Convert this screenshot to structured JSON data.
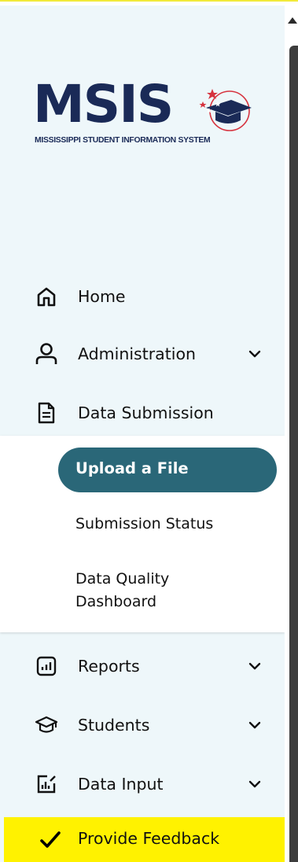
{
  "logo": {
    "wordmark": "MSIS",
    "tagline": "MISSISSIPPI STUDENT INFORMATION SYSTEM"
  },
  "nav": {
    "home": {
      "label": "Home",
      "icon": "home-icon"
    },
    "administration": {
      "label": "Administration",
      "icon": "user-icon",
      "expandable": true
    },
    "data_submission": {
      "label": "Data Submission",
      "icon": "document-icon",
      "expanded": true
    },
    "data_submission_children": [
      {
        "label": "Upload a File",
        "active": true
      },
      {
        "label": "Submission Status"
      },
      {
        "label": "Data Quality Dashboard"
      }
    ],
    "reports": {
      "label": "Reports",
      "icon": "bar-chart-icon",
      "expandable": true
    },
    "students": {
      "label": "Students",
      "icon": "graduation-cap-icon",
      "expandable": true
    },
    "data_input": {
      "label": "Data Input",
      "icon": "edit-chart-icon",
      "expandable": true
    },
    "feedback": {
      "label": "Provide Feedback",
      "icon": "checkmark-icon"
    }
  },
  "colors": {
    "sidebar_bg": "#eef7fa",
    "active_pill": "#2a6778",
    "feedback_bg": "#fff200",
    "logo_navy": "#1a2a57",
    "logo_red": "#d6333f"
  }
}
